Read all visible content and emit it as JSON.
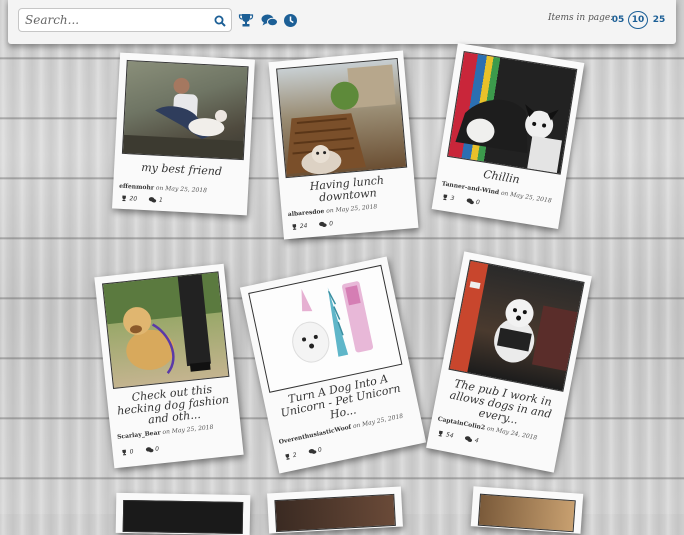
{
  "search": {
    "placeholder": "Search..."
  },
  "toolbar": {
    "icons": [
      "trophy-icon",
      "comments-icon",
      "clock-icon"
    ],
    "items_label": "Items in page:",
    "page_sizes": [
      "05",
      "10",
      "25"
    ],
    "selected_page_size": "10",
    "accent_color": "#1c5f96"
  },
  "posts": [
    {
      "title": "my best friend",
      "author": "effenmohr",
      "date_prefix": "on",
      "date": "May 25, 2018",
      "likes": "20",
      "comments": "1"
    },
    {
      "title": "Having lunch downtown",
      "author": "albaresdoe",
      "date_prefix": "on",
      "date": "May 25, 2018",
      "likes": "24",
      "comments": "0"
    },
    {
      "title": "Chillin",
      "author": "Tanner-and-Wind",
      "date_prefix": "on",
      "date": "May 25, 2018",
      "likes": "3",
      "comments": "0"
    },
    {
      "title": "Check out this hecking dog fashion and oth...",
      "author": "Scarlay_Bear",
      "date_prefix": "on",
      "date": "May 25, 2018",
      "likes": "0",
      "comments": "0"
    },
    {
      "title": "Turn A Dog Into A Unicorn - Pet Unicorn Ho...",
      "author": "OverenthusiasticWoof",
      "date_prefix": "on",
      "date": "May 25, 2018",
      "likes": "2",
      "comments": "0"
    },
    {
      "title": "The pub I work in allows dogs in and every...",
      "author": "CaptainColin2",
      "date_prefix": "on",
      "date": "May 24, 2018",
      "likes": "54",
      "comments": "4"
    }
  ]
}
